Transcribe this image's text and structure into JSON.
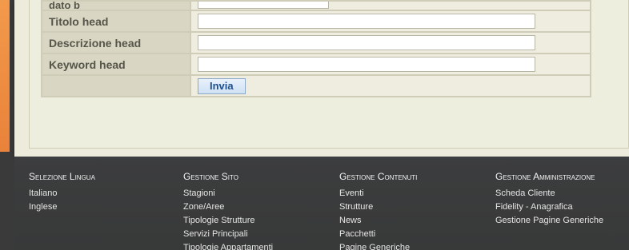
{
  "form": {
    "rows": [
      {
        "label": "dato b",
        "value": ""
      },
      {
        "label": "Titolo head",
        "value": ""
      },
      {
        "label": "Descrizione head",
        "value": ""
      },
      {
        "label": "Keyword head",
        "value": ""
      }
    ],
    "submit_label": "Invia"
  },
  "footer": {
    "columns": [
      {
        "heading": "Selezione Lingua",
        "links": [
          "Italiano",
          "Inglese"
        ]
      },
      {
        "heading": "Gestione Sito",
        "links": [
          "Stagioni",
          "Zone/Aree",
          "Tipologie Strutture",
          "Servizi Principali",
          "Tipologie Appartamenti"
        ]
      },
      {
        "heading": "Gestione Contenuti",
        "links": [
          "Eventi",
          "Strutture",
          "News",
          "Pacchetti",
          "Pagine Generiche"
        ]
      },
      {
        "heading": "Gestione Amministrazione",
        "links": [
          "Scheda Cliente",
          "Fidelity - Anagrafica",
          "Gestione Pagine Generiche"
        ]
      }
    ]
  },
  "colors": {
    "accent": "#e9823a",
    "footer_background": "#3a3a3a",
    "label_cell": "#d9d7c3",
    "button_text": "#1d4f8e"
  }
}
